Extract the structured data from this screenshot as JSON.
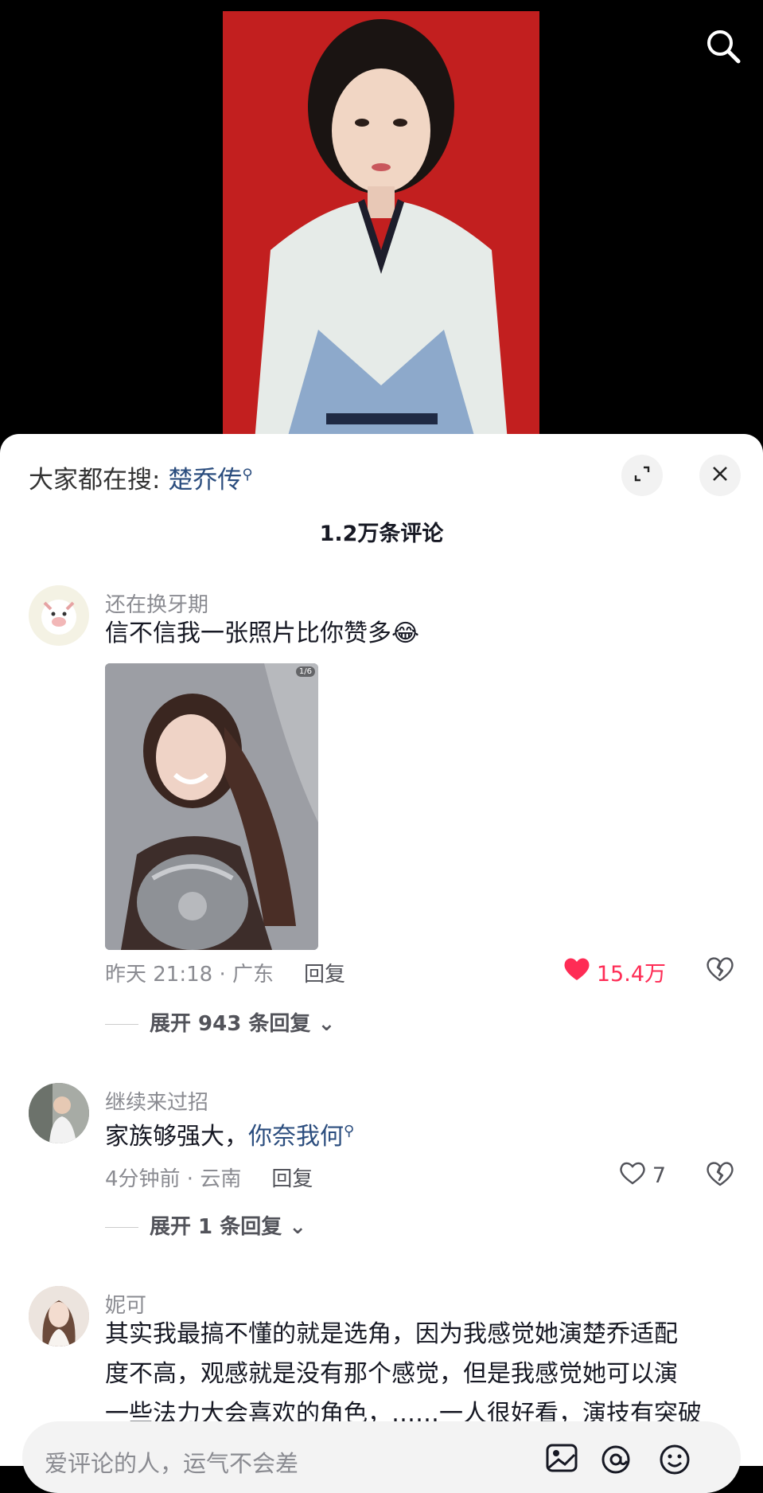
{
  "video": {
    "search_icon": "search-icon"
  },
  "sheet": {
    "hot_search_label": "大家都在搜:",
    "hot_search_keyword": "楚乔传",
    "comment_count": "1.2万条评论"
  },
  "comments": [
    {
      "username": "还在换牙期",
      "text": "信不信我一张照片比你赞多",
      "emoji": "😂",
      "image_badge": "1/6",
      "time_location": "昨天 21:18 · 广东",
      "reply_label": "回复",
      "likes": "15.4万",
      "liked": true,
      "expand_label": "展开 943 条回复"
    },
    {
      "username": "继续来过招",
      "text_prefix": "家族够强大，",
      "text_link": "你奈我何",
      "time_location": "4分钟前 · 云南",
      "reply_label": "回复",
      "likes": "7",
      "liked": false,
      "expand_label": "展开 1 条回复"
    },
    {
      "username": "妮可",
      "text_line1": "其实我最搞不懂的就是选角，因为我感觉她演楚乔适配",
      "text_line2": "度不高，观感就是没有那个感觉，但是我感觉她可以演",
      "text_line3": "一些法力大会喜欢的角色，……一人很好看，演技有突破"
    }
  ],
  "input": {
    "placeholder": "爱评论的人，运气不会差"
  },
  "colors": {
    "accent_like": "#fe2c55",
    "link": "#2b4d7e"
  }
}
